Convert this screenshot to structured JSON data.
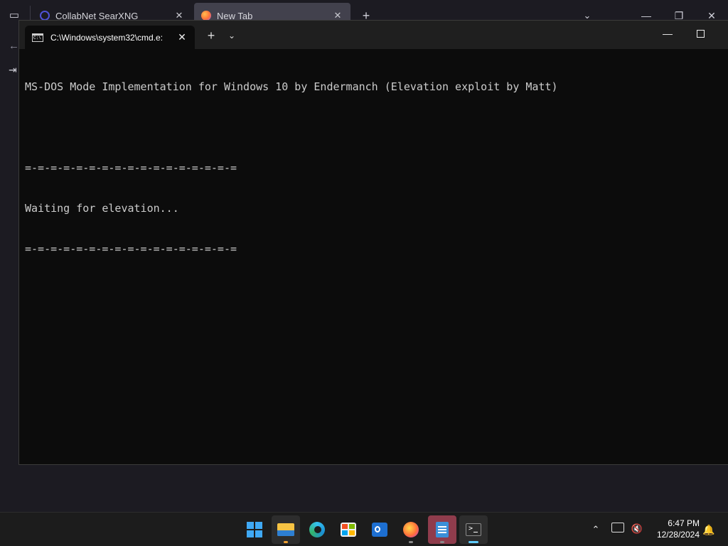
{
  "browser": {
    "tabs": [
      {
        "label": "CollabNet SearXNG"
      },
      {
        "label": "New Tab"
      }
    ],
    "new_tab_symbol": "+",
    "list_all_tabs_symbol": "⌄",
    "window_controls": {
      "minimize": "—",
      "restore": "❐",
      "close": "✕"
    },
    "back_symbol": "←",
    "login_symbol": "⇥"
  },
  "terminal": {
    "tab_title": "C:\\Windows\\system32\\cmd.e:",
    "close_symbol": "✕",
    "new_tab_symbol": "+",
    "dropdown_symbol": "⌄",
    "minimize_symbol": "—",
    "lines": [
      "MS-DOS Mode Implementation for Windows 10 by Endermanch (Elevation exploit by Matt)",
      "",
      "=-=-=-=-=-=-=-=-=-=-=-=-=-=-=-=-=",
      "Waiting for elevation...",
      "=-=-=-=-=-=-=-=-=-=-=-=-=-=-=-=-="
    ]
  },
  "taskbar": {
    "apps": [
      {
        "name": "start",
        "icon": "windows-logo-icon"
      },
      {
        "name": "file-explorer",
        "icon": "folder-icon"
      },
      {
        "name": "edge",
        "icon": "edge-icon"
      },
      {
        "name": "microsoft-store",
        "icon": "store-icon"
      },
      {
        "name": "outlook",
        "icon": "outlook-icon"
      },
      {
        "name": "firefox",
        "icon": "firefox-icon"
      },
      {
        "name": "notepad",
        "icon": "notepad-icon"
      },
      {
        "name": "terminal",
        "icon": "terminal-icon"
      }
    ],
    "tray_chevron": "⌃",
    "volume_symbol": "🔇",
    "time": "6:47 PM",
    "date": "12/28/2024",
    "bell_symbol": "🔔"
  },
  "colors": {
    "terminal_bg": "#0c0c0c",
    "terminal_text": "#cccccc",
    "taskbar_bg": "#1c1c1c",
    "accent": "#60cdff"
  }
}
